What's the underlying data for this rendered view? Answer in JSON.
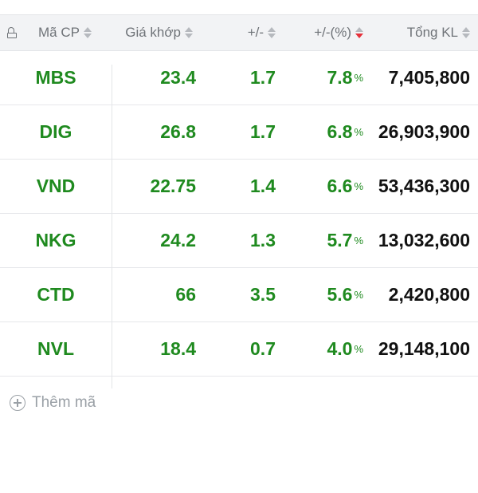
{
  "header": {
    "symbol_label": "Mã CP",
    "price_label": "Giá khớp",
    "change_label": "+/-",
    "pct_label": "+/-(%)",
    "volume_label": "Tổng KL"
  },
  "colors": {
    "up": "#1f8a1f",
    "sort_active": "#e5303a",
    "volume": "#111111"
  },
  "rows": [
    {
      "symbol": "MBS",
      "price": "23.4",
      "change": "1.7",
      "pct": "7.8",
      "pct_unit": "%",
      "volume": "7,405,800"
    },
    {
      "symbol": "DIG",
      "price": "26.8",
      "change": "1.7",
      "pct": "6.8",
      "pct_unit": "%",
      "volume": "26,903,900"
    },
    {
      "symbol": "VND",
      "price": "22.75",
      "change": "1.4",
      "pct": "6.6",
      "pct_unit": "%",
      "volume": "53,436,300"
    },
    {
      "symbol": "NKG",
      "price": "24.2",
      "change": "1.3",
      "pct": "5.7",
      "pct_unit": "%",
      "volume": "13,032,600"
    },
    {
      "symbol": "CTD",
      "price": "66",
      "change": "3.5",
      "pct": "5.6",
      "pct_unit": "%",
      "volume": "2,420,800"
    },
    {
      "symbol": "NVL",
      "price": "18.4",
      "change": "0.7",
      "pct": "4.0",
      "pct_unit": "%",
      "volume": "29,148,100"
    }
  ],
  "add": {
    "label": "Thêm mã"
  }
}
